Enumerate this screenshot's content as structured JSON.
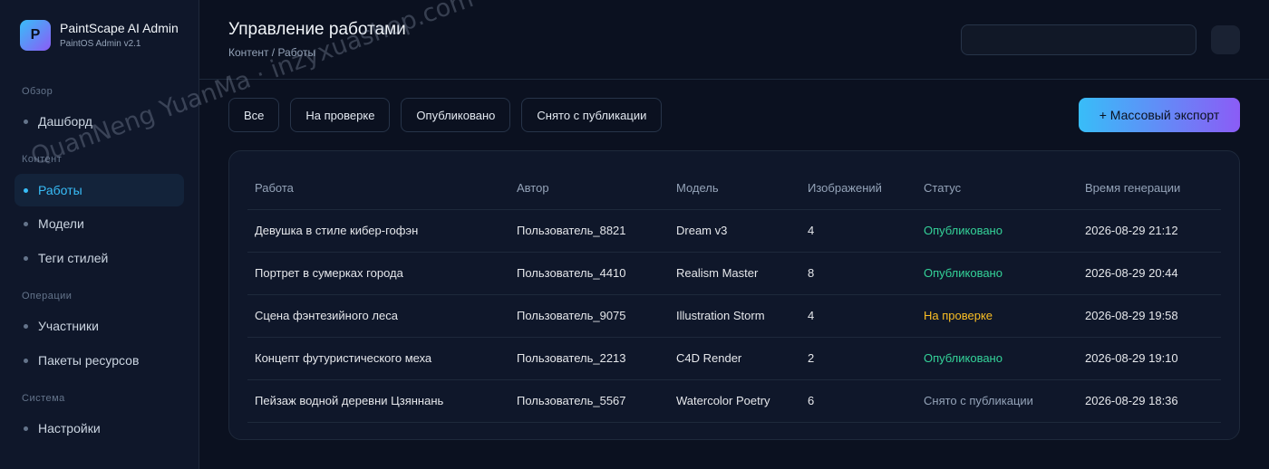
{
  "brand": {
    "logo_letter": "P",
    "name": "PaintScape AI Admin",
    "version": "PaintOS Admin v2.1"
  },
  "sidebar": {
    "sections": [
      {
        "title": "Обзор"
      },
      {
        "title": "Контент"
      },
      {
        "title": "Операции"
      },
      {
        "title": "Система"
      }
    ],
    "items": [
      {
        "label": "Дашборд"
      },
      {
        "label": "Работы"
      },
      {
        "label": "Модели"
      },
      {
        "label": "Теги стилей"
      },
      {
        "label": "Участники"
      },
      {
        "label": "Пакеты ресурсов"
      },
      {
        "label": "Настройки"
      }
    ],
    "active_item": "Работы"
  },
  "header": {
    "title": "Управление работами",
    "breadcrumb": "Контент / Работы",
    "search_value": ""
  },
  "filters": [
    "Все",
    "На проверке",
    "Опубликовано",
    "Снято с публикации"
  ],
  "export_button": "+ Массовый экспорт",
  "table": {
    "columns": [
      "Работа",
      "Автор",
      "Модель",
      "Изображений",
      "Статус",
      "Время генерации"
    ],
    "rows": [
      {
        "work": "Девушка в стиле кибер-гофэн",
        "author": "Пользователь_8821",
        "model": "Dream v3",
        "images": "4",
        "status": "Опубликовано",
        "time": "2026-08-29 21:12"
      },
      {
        "work": "Портрет в сумерках города",
        "author": "Пользователь_4410",
        "model": "Realism Master",
        "images": "8",
        "status": "Опубликовано",
        "time": "2026-08-29 20:44"
      },
      {
        "work": "Сцена фэнтезийного леса",
        "author": "Пользователь_9075",
        "model": "Illustration Storm",
        "images": "4",
        "status": "На проверке",
        "time": "2026-08-29 19:58"
      },
      {
        "work": "Концепт футуристического меха",
        "author": "Пользователь_2213",
        "model": "C4D Render",
        "images": "2",
        "status": "Опубликовано",
        "time": "2026-08-29 19:10"
      },
      {
        "work": "Пейзаж водной деревни Цзяннань",
        "author": "Пользователь_5567",
        "model": "Watercolor Poetry",
        "images": "6",
        "status": "Снято с публикации",
        "time": "2026-08-29 18:36"
      }
    ]
  },
  "colors": {
    "accent": "#38bdf8",
    "accent_end": "#8b5cf6",
    "status_published": "#34d399",
    "status_review": "#fbbf24",
    "status_unpublished": "#94a3b8"
  },
  "watermark": "QuanNeng YuanMa · inzyxuashop.com"
}
